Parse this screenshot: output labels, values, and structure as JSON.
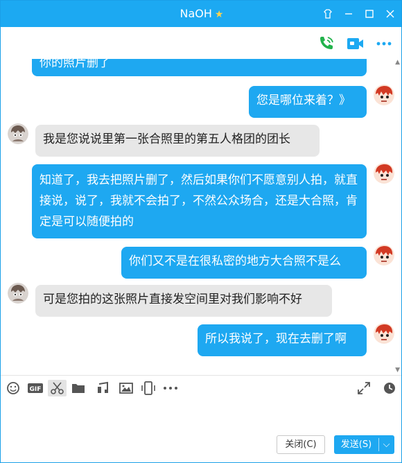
{
  "window": {
    "title": "NaOH",
    "title_star": "★",
    "colors": {
      "accent": "#1ca9f2",
      "bubble_out": "#1ea8f1",
      "bubble_in": "#e7e7e7"
    }
  },
  "window_controls": [
    {
      "name": "skin-icon"
    },
    {
      "name": "minimize-icon"
    },
    {
      "name": "maximize-icon"
    },
    {
      "name": "close-icon"
    }
  ],
  "toolbar": {
    "icons": [
      "phone-call-icon",
      "video-call-icon",
      "more-icon"
    ]
  },
  "chat": {
    "messages": [
      {
        "direction": "out",
        "text": "你的照片删了"
      },
      {
        "direction": "out",
        "text": "您是哪位来着？》"
      },
      {
        "direction": "in",
        "text": "我是您说说里第一张合照里的第五人格团的团长"
      },
      {
        "direction": "out",
        "text": "知道了，我去把照片删了，然后如果你们不愿意别人拍，就直接说，说了，我就不会拍了，不然公众场合，还是大合照，肯定是可以随便拍的"
      },
      {
        "direction": "out",
        "text": "你们又不是在很私密的地方大合照不是么"
      },
      {
        "direction": "in",
        "text": "可是您拍的这张照片直接发空间里对我们影响不好"
      },
      {
        "direction": "out",
        "text": "所以我说了，现在去删了啊"
      }
    ]
  },
  "input_toolbar": {
    "icons": [
      "emoji-icon",
      "gif-icon",
      "screenshot-scissors-icon",
      "folder-icon",
      "music-icon",
      "image-icon",
      "shake-icon",
      "more-icon",
      "expand-icon",
      "history-clock-icon"
    ],
    "gif_label": "GIF"
  },
  "actions": {
    "close_label": "关闭(C)",
    "send_label": "发送(S)",
    "send_dropdown": "⌵"
  }
}
